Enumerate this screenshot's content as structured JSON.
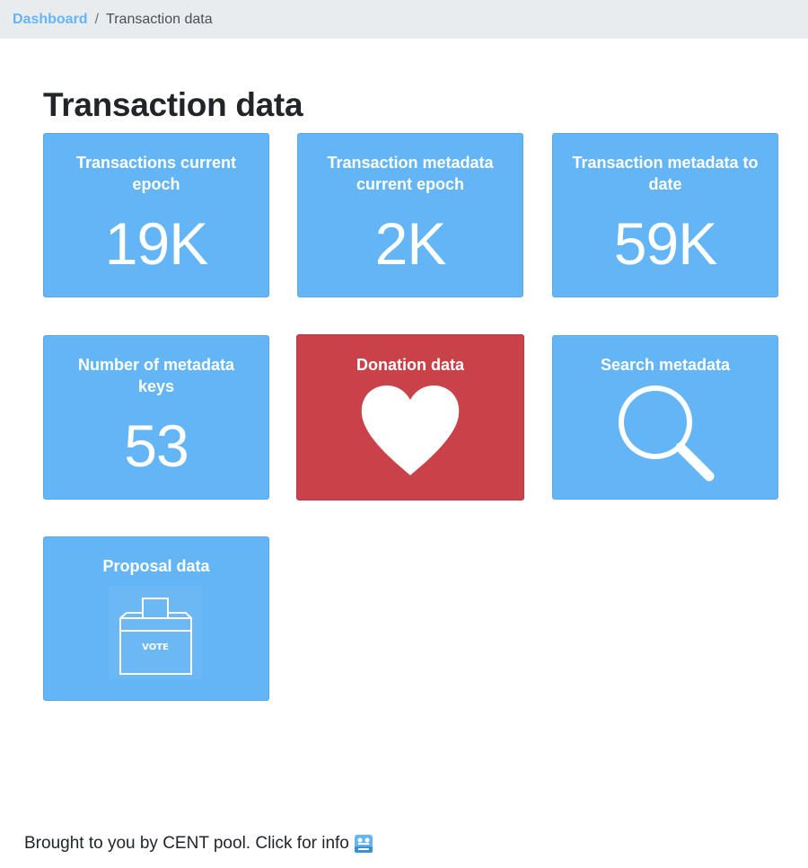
{
  "breadcrumb": {
    "parent": "Dashboard",
    "separator": "/",
    "current": "Transaction data"
  },
  "page": {
    "title": "Transaction data"
  },
  "tiles": [
    {
      "label": "Transactions current epoch",
      "value": "19K"
    },
    {
      "label": "Transaction metadata current epoch",
      "value": "2K"
    },
    {
      "label": "Transaction metadata to date",
      "value": "59K"
    },
    {
      "label": "Number of metadata keys",
      "value": "53"
    },
    {
      "label": "Donation data",
      "icon": "heart-icon"
    },
    {
      "label": "Search metadata",
      "icon": "magnifier-icon"
    },
    {
      "label": "Proposal data",
      "icon": "ballot-box-icon",
      "icon_text": "VOTE"
    }
  ],
  "footer": {
    "text": "Brought to you by CENT pool. Click for info",
    "logo_icon": "cent-pool-logo-icon"
  },
  "colors": {
    "tile_blue": "#64b5f6",
    "tile_red": "#c9424a",
    "breadcrumb_bg": "#e9ecef",
    "link": "#64b5f6"
  }
}
